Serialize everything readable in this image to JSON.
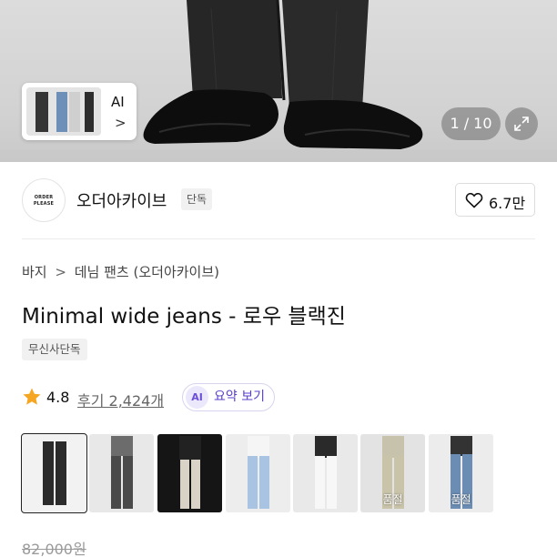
{
  "gallery": {
    "ai_label": "AI",
    "ai_chevron": ">",
    "counter": "1 / 10"
  },
  "brand": {
    "logo_line1": "ORDER",
    "logo_line2": "PLEASE",
    "name": "오더아카이브",
    "badge": "단독",
    "likes": "6.7만"
  },
  "breadcrumb": {
    "items": [
      "바지",
      "데님 팬츠 (오더아카이브)"
    ],
    "separator": ">"
  },
  "product": {
    "title": "Minimal wide jeans - 로우 블랙진",
    "tag": "무신사단독",
    "rating": "4.8",
    "reviews": "후기 2,424개",
    "ai_badge": "AI",
    "ai_summary": "요약 보기",
    "original_price": "82,000원"
  },
  "swatches": [
    {
      "color": "#2b2b2b",
      "bg": "#f2f2f2",
      "soldout": ""
    },
    {
      "color": "#4a4a4a",
      "bg": "#e8e8e8",
      "soldout": ""
    },
    {
      "color": "#d8d3c6",
      "bg": "#151515",
      "soldout": ""
    },
    {
      "color": "#a9c3e3",
      "bg": "#ededed",
      "soldout": ""
    },
    {
      "color": "#f3f3f3",
      "bg": "#e9e9e9",
      "soldout": ""
    },
    {
      "color": "#c9c3a9",
      "bg": "#e3e3e3",
      "soldout": "품절"
    },
    {
      "color": "#6b8db3",
      "bg": "#ececec",
      "soldout": "품절"
    }
  ],
  "colors": {
    "accent_purple": "#5a3fc8",
    "star": "#f5a623"
  }
}
